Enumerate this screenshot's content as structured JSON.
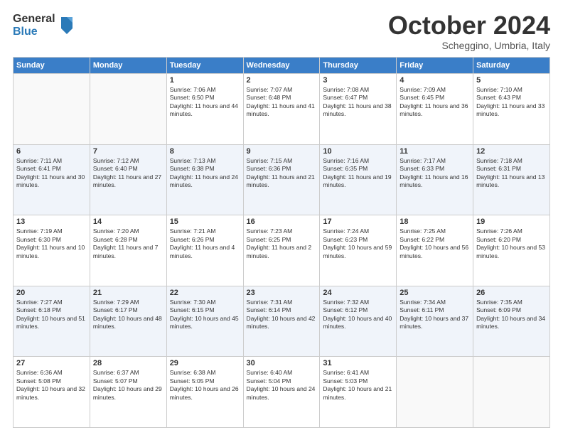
{
  "logo": {
    "general": "General",
    "blue": "Blue"
  },
  "header": {
    "month": "October 2024",
    "location": "Scheggino, Umbria, Italy"
  },
  "weekdays": [
    "Sunday",
    "Monday",
    "Tuesday",
    "Wednesday",
    "Thursday",
    "Friday",
    "Saturday"
  ],
  "weeks": [
    [
      {
        "day": "",
        "sunrise": "",
        "sunset": "",
        "daylight": ""
      },
      {
        "day": "",
        "sunrise": "",
        "sunset": "",
        "daylight": ""
      },
      {
        "day": "1",
        "sunrise": "Sunrise: 7:06 AM",
        "sunset": "Sunset: 6:50 PM",
        "daylight": "Daylight: 11 hours and 44 minutes."
      },
      {
        "day": "2",
        "sunrise": "Sunrise: 7:07 AM",
        "sunset": "Sunset: 6:48 PM",
        "daylight": "Daylight: 11 hours and 41 minutes."
      },
      {
        "day": "3",
        "sunrise": "Sunrise: 7:08 AM",
        "sunset": "Sunset: 6:47 PM",
        "daylight": "Daylight: 11 hours and 38 minutes."
      },
      {
        "day": "4",
        "sunrise": "Sunrise: 7:09 AM",
        "sunset": "Sunset: 6:45 PM",
        "daylight": "Daylight: 11 hours and 36 minutes."
      },
      {
        "day": "5",
        "sunrise": "Sunrise: 7:10 AM",
        "sunset": "Sunset: 6:43 PM",
        "daylight": "Daylight: 11 hours and 33 minutes."
      }
    ],
    [
      {
        "day": "6",
        "sunrise": "Sunrise: 7:11 AM",
        "sunset": "Sunset: 6:41 PM",
        "daylight": "Daylight: 11 hours and 30 minutes."
      },
      {
        "day": "7",
        "sunrise": "Sunrise: 7:12 AM",
        "sunset": "Sunset: 6:40 PM",
        "daylight": "Daylight: 11 hours and 27 minutes."
      },
      {
        "day": "8",
        "sunrise": "Sunrise: 7:13 AM",
        "sunset": "Sunset: 6:38 PM",
        "daylight": "Daylight: 11 hours and 24 minutes."
      },
      {
        "day": "9",
        "sunrise": "Sunrise: 7:15 AM",
        "sunset": "Sunset: 6:36 PM",
        "daylight": "Daylight: 11 hours and 21 minutes."
      },
      {
        "day": "10",
        "sunrise": "Sunrise: 7:16 AM",
        "sunset": "Sunset: 6:35 PM",
        "daylight": "Daylight: 11 hours and 19 minutes."
      },
      {
        "day": "11",
        "sunrise": "Sunrise: 7:17 AM",
        "sunset": "Sunset: 6:33 PM",
        "daylight": "Daylight: 11 hours and 16 minutes."
      },
      {
        "day": "12",
        "sunrise": "Sunrise: 7:18 AM",
        "sunset": "Sunset: 6:31 PM",
        "daylight": "Daylight: 11 hours and 13 minutes."
      }
    ],
    [
      {
        "day": "13",
        "sunrise": "Sunrise: 7:19 AM",
        "sunset": "Sunset: 6:30 PM",
        "daylight": "Daylight: 11 hours and 10 minutes."
      },
      {
        "day": "14",
        "sunrise": "Sunrise: 7:20 AM",
        "sunset": "Sunset: 6:28 PM",
        "daylight": "Daylight: 11 hours and 7 minutes."
      },
      {
        "day": "15",
        "sunrise": "Sunrise: 7:21 AM",
        "sunset": "Sunset: 6:26 PM",
        "daylight": "Daylight: 11 hours and 4 minutes."
      },
      {
        "day": "16",
        "sunrise": "Sunrise: 7:23 AM",
        "sunset": "Sunset: 6:25 PM",
        "daylight": "Daylight: 11 hours and 2 minutes."
      },
      {
        "day": "17",
        "sunrise": "Sunrise: 7:24 AM",
        "sunset": "Sunset: 6:23 PM",
        "daylight": "Daylight: 10 hours and 59 minutes."
      },
      {
        "day": "18",
        "sunrise": "Sunrise: 7:25 AM",
        "sunset": "Sunset: 6:22 PM",
        "daylight": "Daylight: 10 hours and 56 minutes."
      },
      {
        "day": "19",
        "sunrise": "Sunrise: 7:26 AM",
        "sunset": "Sunset: 6:20 PM",
        "daylight": "Daylight: 10 hours and 53 minutes."
      }
    ],
    [
      {
        "day": "20",
        "sunrise": "Sunrise: 7:27 AM",
        "sunset": "Sunset: 6:18 PM",
        "daylight": "Daylight: 10 hours and 51 minutes."
      },
      {
        "day": "21",
        "sunrise": "Sunrise: 7:29 AM",
        "sunset": "Sunset: 6:17 PM",
        "daylight": "Daylight: 10 hours and 48 minutes."
      },
      {
        "day": "22",
        "sunrise": "Sunrise: 7:30 AM",
        "sunset": "Sunset: 6:15 PM",
        "daylight": "Daylight: 10 hours and 45 minutes."
      },
      {
        "day": "23",
        "sunrise": "Sunrise: 7:31 AM",
        "sunset": "Sunset: 6:14 PM",
        "daylight": "Daylight: 10 hours and 42 minutes."
      },
      {
        "day": "24",
        "sunrise": "Sunrise: 7:32 AM",
        "sunset": "Sunset: 6:12 PM",
        "daylight": "Daylight: 10 hours and 40 minutes."
      },
      {
        "day": "25",
        "sunrise": "Sunrise: 7:34 AM",
        "sunset": "Sunset: 6:11 PM",
        "daylight": "Daylight: 10 hours and 37 minutes."
      },
      {
        "day": "26",
        "sunrise": "Sunrise: 7:35 AM",
        "sunset": "Sunset: 6:09 PM",
        "daylight": "Daylight: 10 hours and 34 minutes."
      }
    ],
    [
      {
        "day": "27",
        "sunrise": "Sunrise: 6:36 AM",
        "sunset": "Sunset: 5:08 PM",
        "daylight": "Daylight: 10 hours and 32 minutes."
      },
      {
        "day": "28",
        "sunrise": "Sunrise: 6:37 AM",
        "sunset": "Sunset: 5:07 PM",
        "daylight": "Daylight: 10 hours and 29 minutes."
      },
      {
        "day": "29",
        "sunrise": "Sunrise: 6:38 AM",
        "sunset": "Sunset: 5:05 PM",
        "daylight": "Daylight: 10 hours and 26 minutes."
      },
      {
        "day": "30",
        "sunrise": "Sunrise: 6:40 AM",
        "sunset": "Sunset: 5:04 PM",
        "daylight": "Daylight: 10 hours and 24 minutes."
      },
      {
        "day": "31",
        "sunrise": "Sunrise: 6:41 AM",
        "sunset": "Sunset: 5:03 PM",
        "daylight": "Daylight: 10 hours and 21 minutes."
      },
      {
        "day": "",
        "sunrise": "",
        "sunset": "",
        "daylight": ""
      },
      {
        "day": "",
        "sunrise": "",
        "sunset": "",
        "daylight": ""
      }
    ]
  ]
}
